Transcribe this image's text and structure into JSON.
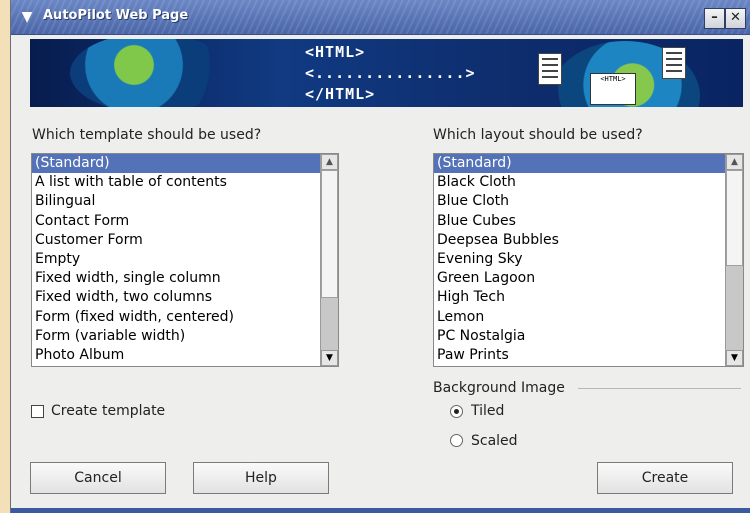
{
  "window": {
    "title": "AutoPilot Web Page"
  },
  "banner": {
    "line1": "<HTML>",
    "line2": "<...............>",
    "line3": "</HTML>",
    "doc_html_label": "<HTML>"
  },
  "template_section": {
    "label": "Which template should be used?",
    "items": [
      "(Standard)",
      "A list with table of contents",
      "Bilingual",
      "Contact Form",
      "Customer Form",
      "Empty",
      "Fixed width, single column",
      "Fixed width, two columns",
      "Form (fixed width, centered)",
      "Form (variable width)",
      "Photo Album"
    ],
    "selected": "(Standard)"
  },
  "layout_section": {
    "label": "Which layout should be used?",
    "items": [
      "(Standard)",
      "Black Cloth",
      "Blue Cloth",
      "Blue Cubes",
      "Deepsea Bubbles",
      "Evening Sky",
      "Green Lagoon",
      "High Tech",
      "Lemon",
      "PC Nostalgia",
      "Paw Prints"
    ],
    "selected": "(Standard)"
  },
  "create_template": {
    "label": "Create template",
    "checked": false
  },
  "background_image": {
    "label": "Background Image",
    "options": [
      "Tiled",
      "Scaled"
    ],
    "selected": "Tiled"
  },
  "buttons": {
    "cancel": "Cancel",
    "help": "Help",
    "create": "Create"
  },
  "colors": {
    "titlebar": "#4a66a8",
    "selection": "#5472b8",
    "banner": "#113a82"
  }
}
